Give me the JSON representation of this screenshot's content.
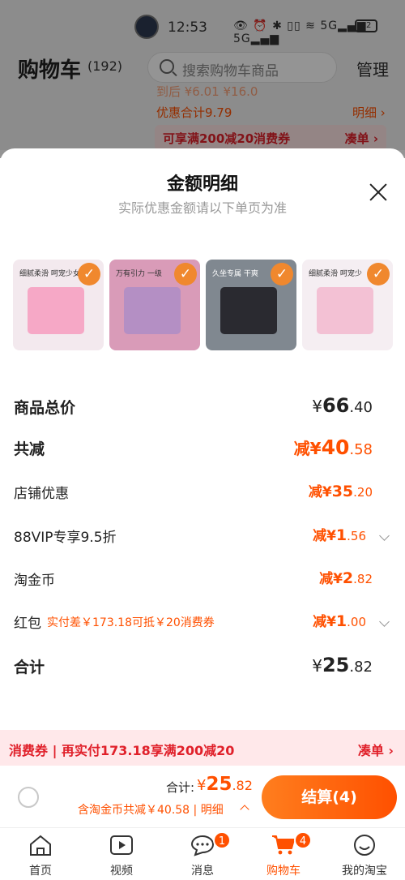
{
  "status": {
    "time": "12:53",
    "icons": "👁 ⏰ ✱ ▯▯ ≋ 5G▂▄▆ 5G▂▄▆",
    "battery": "82"
  },
  "header": {
    "title": "购物车",
    "count": "(192)",
    "search_placeholder": "搜索购物车商品",
    "manage": "管理"
  },
  "background": {
    "row1": "到后 ¥6.01 ¥16.0",
    "discount_total": "优惠合计9.79",
    "detail_link": "明细 ›",
    "coupon_text": "可享满200减20消费券",
    "coupon_link": "凑单 ›"
  },
  "sheet": {
    "title": "金额明细",
    "subtitle": "实际优惠金额请以下单页为准",
    "thumbnails": [
      {
        "caption": "细腻柔滑 呵宠少女",
        "bg": "#f3e9ee",
        "pack": "#f6a8c6",
        "check": "✓"
      },
      {
        "caption": "万有引力 一级",
        "bg": "#d99bb8",
        "pack": "#b48fc4",
        "check": "✓"
      },
      {
        "caption": "久坐专属 干爽",
        "bg": "#808890",
        "pack": "#2a2a30",
        "check": "✓"
      },
      {
        "caption": "细腻柔滑 呵宠少",
        "bg": "#f5eef2",
        "pack": "#f3c1d4",
        "check": "✓"
      }
    ],
    "rows": [
      {
        "label": "商品总价",
        "prefix": "",
        "cur": "¥",
        "int": "66",
        "dec": ".40"
      },
      {
        "label": "共减",
        "prefix": "减",
        "cur": "¥",
        "int": "40",
        "dec": ".58"
      },
      {
        "label": "店铺优惠",
        "prefix": "减",
        "cur": "¥",
        "int": "35",
        "dec": ".20"
      },
      {
        "label": "88VIP专享9.5折",
        "prefix": "减",
        "cur": "¥",
        "int": "1",
        "dec": ".56"
      },
      {
        "label": "淘金币",
        "prefix": "减",
        "cur": "¥",
        "int": "2",
        "dec": ".82"
      },
      {
        "label": "红包",
        "note": "实付差￥173.18可抵￥20消费券",
        "prefix": "减",
        "cur": "¥",
        "int": "1",
        "dec": ".00"
      },
      {
        "label": "合计",
        "prefix": "",
        "cur": "¥",
        "int": "25",
        "dec": ".82"
      }
    ],
    "coupon_bar": {
      "text": "消费券 | 再实付173.18享满200减20",
      "link": "凑单 ›"
    },
    "checkout": {
      "total_label": "合计:",
      "cur": "¥",
      "int": "25",
      "dec": ".82",
      "sub": "含淘金币共减￥40.58 | 明细",
      "button": "结算(4)"
    }
  },
  "tabbar": {
    "tabs": [
      {
        "label": "首页",
        "icon": "home-icon",
        "badge": ""
      },
      {
        "label": "视频",
        "icon": "video-icon",
        "badge": ""
      },
      {
        "label": "消息",
        "icon": "message-icon",
        "badge": "1"
      },
      {
        "label": "购物车",
        "icon": "cart-icon",
        "badge": "4"
      },
      {
        "label": "我的淘宝",
        "icon": "profile-icon",
        "badge": ""
      }
    ]
  },
  "colors": {
    "accent": "#ff5000",
    "coupon_red": "#e0202a",
    "coupon_bg": "#ffe8ea"
  }
}
